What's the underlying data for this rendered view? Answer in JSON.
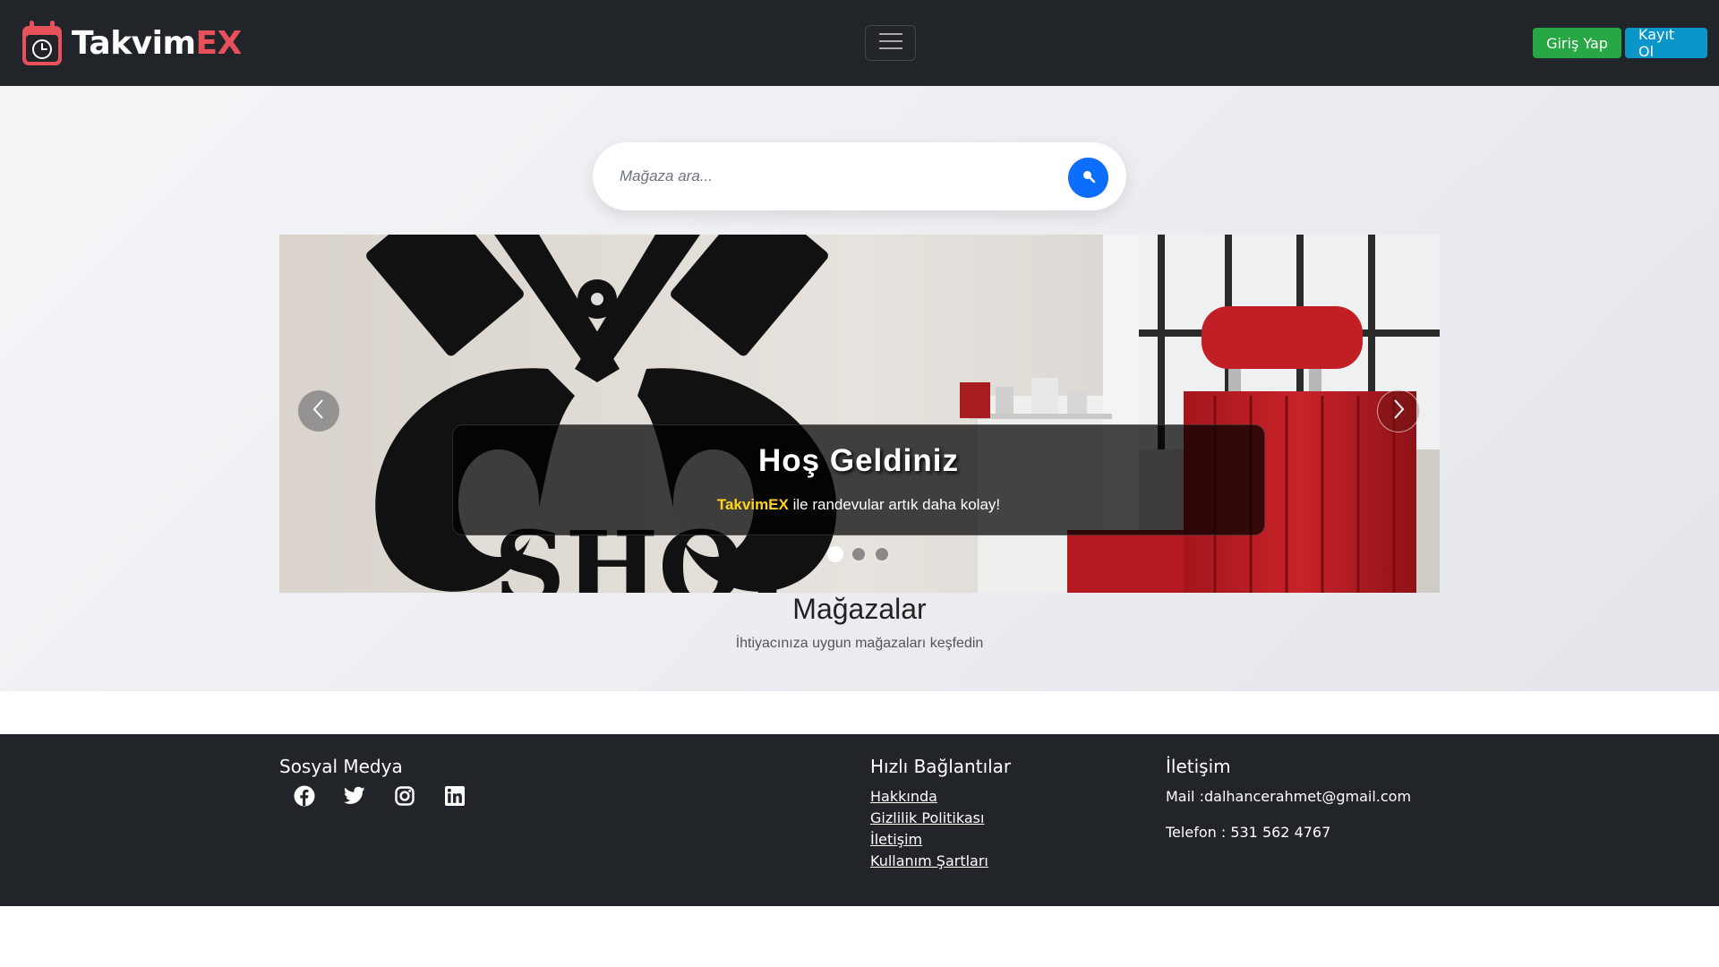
{
  "navbar": {
    "brand_part1": "Takvim",
    "brand_part2": "EX",
    "brand_color": "#e8505b",
    "menu_icon": "hamburger-icon",
    "login_label": "Giriş Yap",
    "register_label": "Kayıt Ol"
  },
  "search": {
    "placeholder": "Mağaza ara...",
    "icon": "search-icon",
    "button_color": "#0d6efd"
  },
  "carousel": {
    "caption_title": "Hoş Geldiniz",
    "caption_highlight": "TakvimEX",
    "caption_text": " ile randevular artık daha kolay!",
    "slide_count": 3,
    "active_slide": 1
  },
  "stores": {
    "title": "Mağazalar",
    "subtitle": "İhtiyacınıza uygun mağazaları keşfedin"
  },
  "footer": {
    "social_title": "Sosyal Medya",
    "social_icons": [
      "facebook-icon",
      "twitter-icon",
      "instagram-icon",
      "linkedin-icon"
    ],
    "links_title": "Hızlı Bağlantılar",
    "links": [
      "Hakkında",
      "Gizlilik Politikası",
      "İletişim",
      "Kullanım Şartları"
    ],
    "contact_title": "İletişim",
    "mail": "Mail :dalhancerahmet@gmail.com",
    "phone": "Telefon : 531 562 4767"
  }
}
